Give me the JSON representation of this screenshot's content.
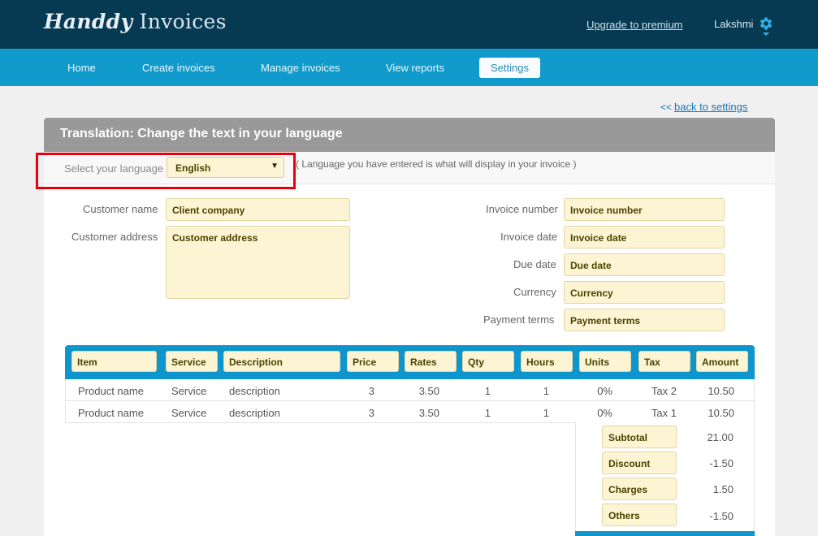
{
  "header": {
    "logo_script": "Handdy",
    "logo_plain": " Invoices",
    "upgrade_link": "Upgrade to premium",
    "username": "Lakshmi",
    "icon": "gear-icon"
  },
  "nav": {
    "items": [
      "Home",
      "Create invoices",
      "Manage invoices",
      "View reports",
      "Settings"
    ],
    "active": "Settings"
  },
  "back": {
    "chevron": "<<",
    "label": "back to settings"
  },
  "panel": {
    "title": "Translation: Change the text in your language",
    "language_label": "Select your language",
    "language_value": "English",
    "language_note": "( Language you have entered is what will display in your invoice )"
  },
  "form": {
    "customer_name_label": "Customer name",
    "customer_name_value": "Client company",
    "customer_address_label": "Customer address",
    "customer_address_value": "Customer address",
    "invoice_number_label": "Invoice number",
    "invoice_number_value": "Invoice number",
    "invoice_date_label": "Invoice date",
    "invoice_date_value": "Invoice date",
    "due_date_label": "Due date",
    "due_date_value": "Due date",
    "currency_label": "Currency",
    "currency_value": "Currency",
    "payment_terms_label": "Payment terms",
    "payment_terms_value": "Payment terms"
  },
  "table": {
    "headers": [
      "Item",
      "Service",
      "Description",
      "Price",
      "Rates",
      "Qty",
      "Hours",
      "Units",
      "Tax",
      "Amount"
    ],
    "rows": [
      [
        "Product name",
        "Service",
        "description",
        "3",
        "3.50",
        "1",
        "1",
        "0%",
        "Tax 2",
        "10.50"
      ],
      [
        "Product name",
        "Service",
        "description",
        "3",
        "3.50",
        "1",
        "1",
        "0%",
        "Tax 1",
        "10.50"
      ]
    ]
  },
  "totals": {
    "labels": [
      "Subtotal",
      "Discount",
      "Charges",
      "Others"
    ],
    "values": [
      "21.00",
      "-1.50",
      "1.50",
      "-1.50"
    ]
  },
  "colors": {
    "header_bg": "#063a52",
    "nav_bg": "#109bcc",
    "field_bg": "#fdf4d4",
    "highlight": "#e8000a"
  }
}
